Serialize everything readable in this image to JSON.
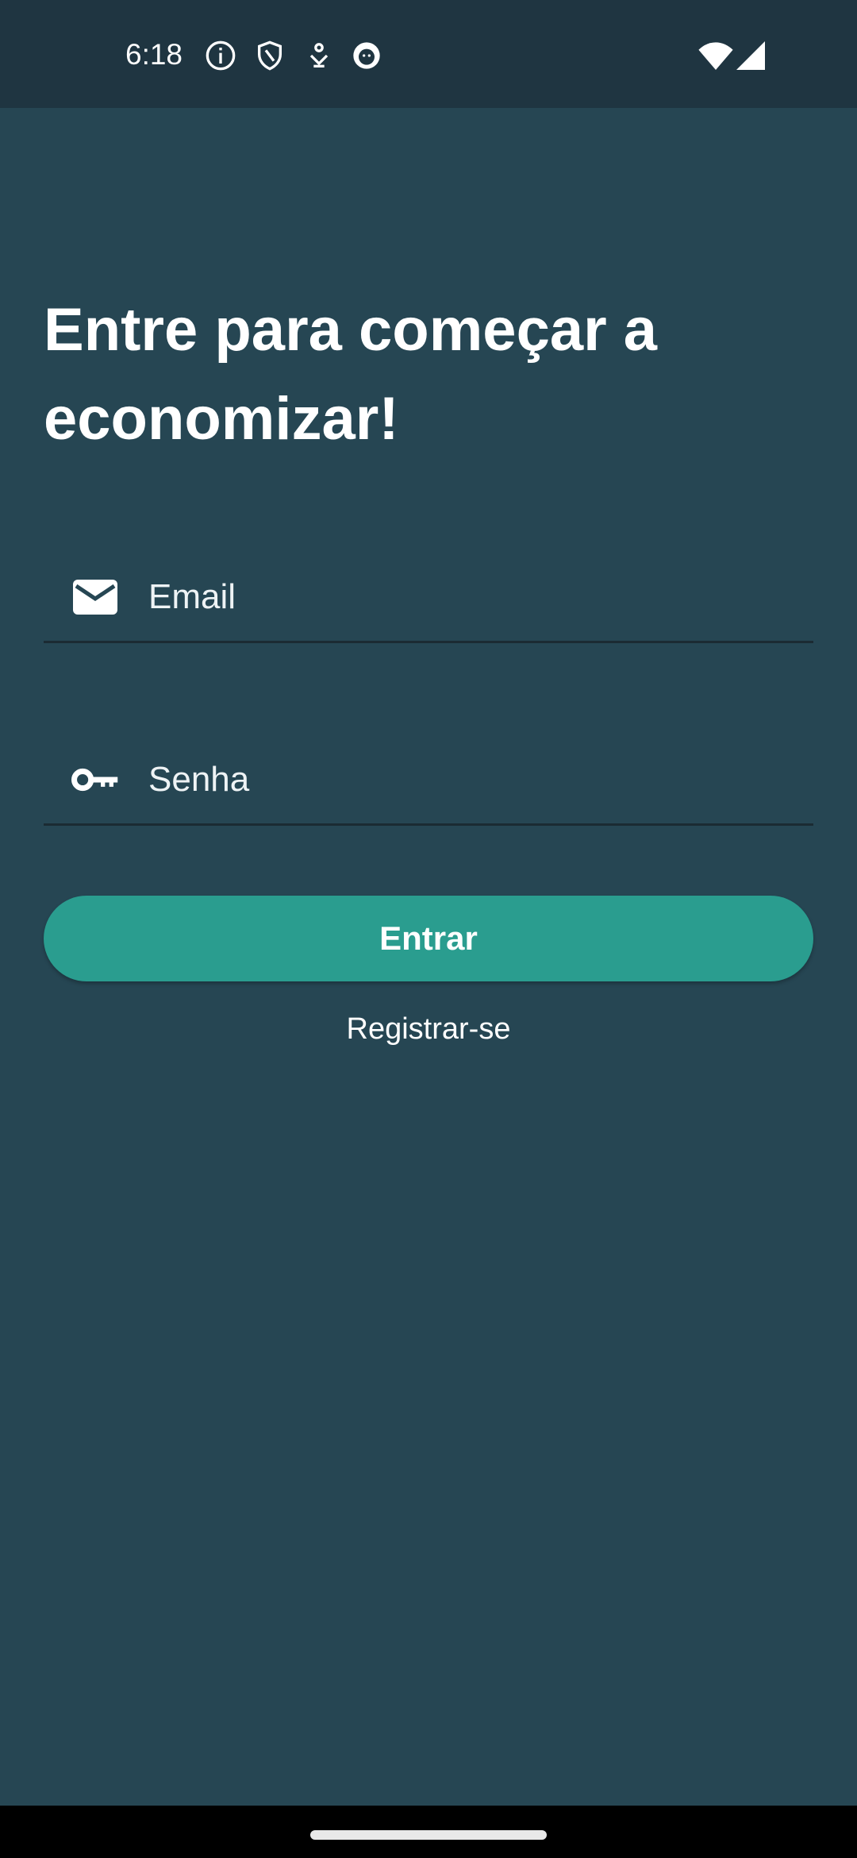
{
  "status_bar": {
    "time": "6:18",
    "icons": [
      "info-icon",
      "shield-icon",
      "download-icon",
      "cat-face-icon",
      "wifi-icon",
      "cell-signal-icon"
    ]
  },
  "login": {
    "title": "Entre para começar a economizar!",
    "email_placeholder": "Email",
    "email_value": "",
    "password_placeholder": "Senha",
    "password_value": "",
    "submit_label": "Entrar",
    "register_label": "Registrar-se"
  },
  "colors": {
    "background": "#264653",
    "status_bar": "#1f3541",
    "accent": "#2a9d8f",
    "divider": "#1b2b33"
  }
}
